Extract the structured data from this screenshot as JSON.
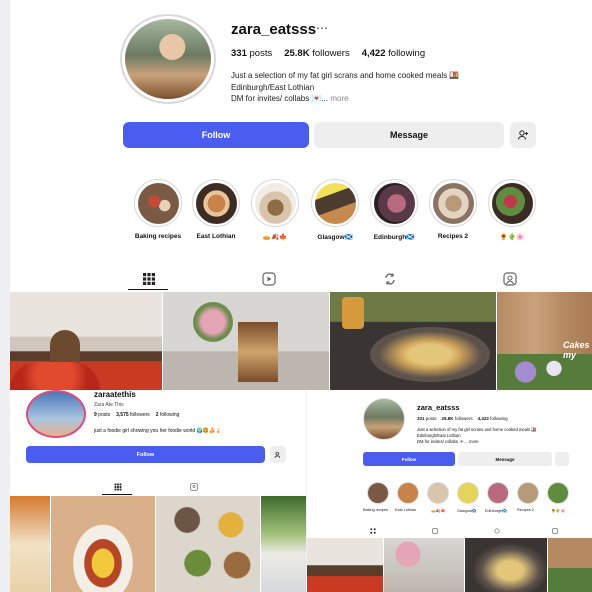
{
  "profile": {
    "username": "zara_eatsss",
    "more_icon": "⋯",
    "posts_count": "331",
    "posts_label": "posts",
    "followers_count": "25.8K",
    "followers_label": "followers",
    "following_count": "4,422",
    "following_label": "following",
    "bio_line1": "Just a selection of my fat girl scrans and home cooked meals 🍱",
    "bio_line2": "Edinburgh/East Lothian",
    "bio_line3": "DM for invites/ collabs 💌...",
    "bio_more": "more"
  },
  "actions": {
    "follow_label": "Follow",
    "message_label": "Message",
    "add_user_icon": "add-user-icon"
  },
  "highlights": [
    {
      "label": "Baking recipes"
    },
    {
      "label": "East Lothian"
    },
    {
      "label": "🥧🍂🍁"
    },
    {
      "label": "Glasgow🏴󠁧󠁢󠁳󠁣󠁴󠁿"
    },
    {
      "label": "Edinburgh🏴󠁧󠁢󠁳󠁣󠁴󠁿"
    },
    {
      "label": "Recipes 2"
    },
    {
      "label": "🌻🌵🌸"
    }
  ],
  "tabs": [
    "grid-icon",
    "reels-icon",
    "tagged-repost-icon",
    "tagged-person-icon"
  ],
  "grid_overlay_text": "Cakes my",
  "sub_left": {
    "username": "zaraatethis",
    "display_name": "Zara Ate This",
    "posts_count": "9",
    "posts_label": "posts",
    "followers_count": "3,575",
    "followers_label": "followers",
    "following_count": "2",
    "following_label": "following",
    "bio": "just a foodie girl showing you her foodie world 🌍🍔🍰🍦",
    "follow_label": "Follow"
  },
  "sub_right": {
    "username": "zara_eatsss",
    "posts_count": "331",
    "posts_label": "posts",
    "followers_count": "25.8K",
    "followers_label": "followers",
    "following_count": "4,422",
    "following_label": "following",
    "bio_line1": "Just a selection of my fat girl scrans and home cooked meals 🍱",
    "bio_line2": "Edinburgh/East Lothian",
    "bio_line3": "DM for invites/ collabs 💌... more",
    "follow_label": "Follow",
    "message_label": "Message",
    "highlights": [
      "Baking recipes",
      "East Lothian",
      "🥧🍂🍁",
      "Glasgow🏴󠁧󠁢󠁳󠁣󠁴󠁿",
      "Edinburgh🏴󠁧󠁢󠁳󠁣󠁴󠁿",
      "Recipes 2",
      "🌻🌵🌸"
    ]
  },
  "colors": {
    "accent": "#4b5cf0",
    "secondary_button": "#eeeeee"
  }
}
